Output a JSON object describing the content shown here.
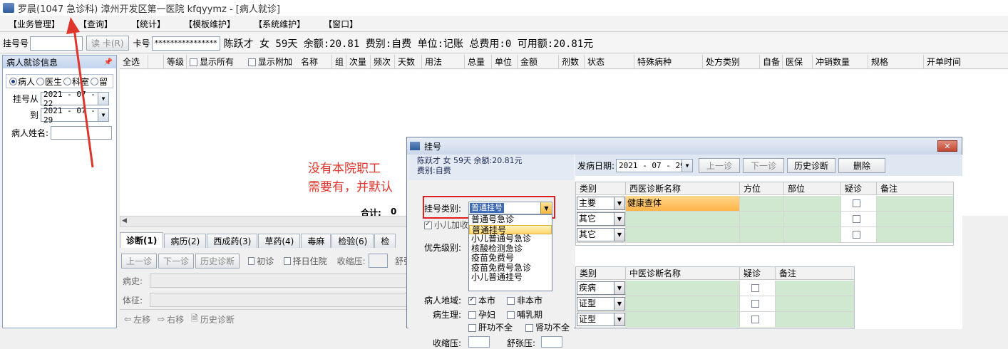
{
  "window": {
    "title": "罗晨(1047 急诊科) 漳州开发区第一医院 kfqyymz - [病人就诊]"
  },
  "menu": [
    "【业务管理】",
    "【查询】",
    "【统计】",
    "【模板维护】",
    "【系统维护】",
    "【窗口】"
  ],
  "patient_bar": {
    "reg_label": "挂号号",
    "reg_value": "",
    "read_card": "读 卡(R)",
    "card_label": "卡号",
    "card_value": "****************",
    "info": "陈跃才 女 59天 余额:20.81 费别:自费 单位:记账 总费用:0 可用额:20.81元"
  },
  "left_panel": {
    "title": "病人就诊信息",
    "radios": [
      "病人",
      "医生",
      "科室",
      "留"
    ],
    "from_label": "挂号从",
    "from_date": "2021 - 07 - 22",
    "to_label": "到",
    "to_date": "2021 - 07 - 29",
    "name_label": "病人姓名:",
    "name_value": ""
  },
  "grid": {
    "columns": [
      "全选",
      "",
      "等级",
      "显示所有",
      "显示附加",
      "名称",
      "组",
      "次量",
      "频次",
      "天数",
      "用法",
      "总量",
      "单位",
      "金额",
      "剂数",
      "状态",
      "特殊病种",
      "处方类别",
      "自备",
      "医保",
      "冲销数量",
      "规格",
      "开单时间"
    ],
    "total_label": "合计:",
    "total_value": "0"
  },
  "tabs": [
    "诊断(1)",
    "病历(2)",
    "西成药(3)",
    "草药(4)",
    "毒麻",
    "检验(6)",
    "检"
  ],
  "diag_toolbar": {
    "prev": "上一诊",
    "next": "下一诊",
    "history": "历史诊断",
    "first_visit": "初诊",
    "select_hospital": "择日住院",
    "systolic": "收缩压:",
    "diastolic": "舒张"
  },
  "diag_fields": {
    "history": "病史:",
    "sign": "体征:"
  },
  "bottom_bar": {
    "left": "左移",
    "right": "右移",
    "history": "历史诊断"
  },
  "annotation": {
    "line1": "没有本院职工",
    "line2": "需要有，并默认"
  },
  "dialog": {
    "title": "挂号",
    "close": "✕",
    "info_line1": "陈跃才 女 59天 余额:20.81元",
    "info_line2": "费别:自费",
    "reg_type_label": "挂号类别:",
    "reg_type_value": "普通挂号",
    "child_label": "小儿加收",
    "priority_label": "优先级别:",
    "options": [
      "普通号急诊",
      "普通挂号",
      "小儿普通号急诊",
      "核酸检测急诊",
      "疫苗免费号",
      "疫苗免费号急诊",
      "小儿普通挂号"
    ],
    "region_label": "病人地域:",
    "local": "本市",
    "nonlocal": "非本市",
    "physio_label": "病生理:",
    "pregnant": "孕妇",
    "lactation": "哺乳期",
    "liver": "肝功不全",
    "kidney": "肾功不全",
    "systolic": "收缩压:",
    "diastolic": "舒张压:",
    "onset_label": "发病日期:",
    "onset_date": "2021 - 07 - 29",
    "prev": "上一诊",
    "next": "下一诊",
    "history": "历史诊断",
    "delete": "删除",
    "wd_headers": [
      "类别",
      "西医诊断名称",
      "方位",
      "部位",
      "疑诊",
      "备注"
    ],
    "wd_rows": [
      {
        "cat": "主要",
        "name": "健康查体"
      },
      {
        "cat": "其它",
        "name": ""
      },
      {
        "cat": "其它",
        "name": ""
      }
    ],
    "cd_headers": [
      "类别",
      "中医诊断名称",
      "疑诊",
      "备注"
    ],
    "cd_rows": [
      {
        "cat": "疾病"
      },
      {
        "cat": "证型"
      },
      {
        "cat": "证型"
      }
    ]
  },
  "colors": {
    "accent_red": "#e0352b",
    "highlight": "#ffd66b",
    "green_cell": "#cfe8cf"
  }
}
